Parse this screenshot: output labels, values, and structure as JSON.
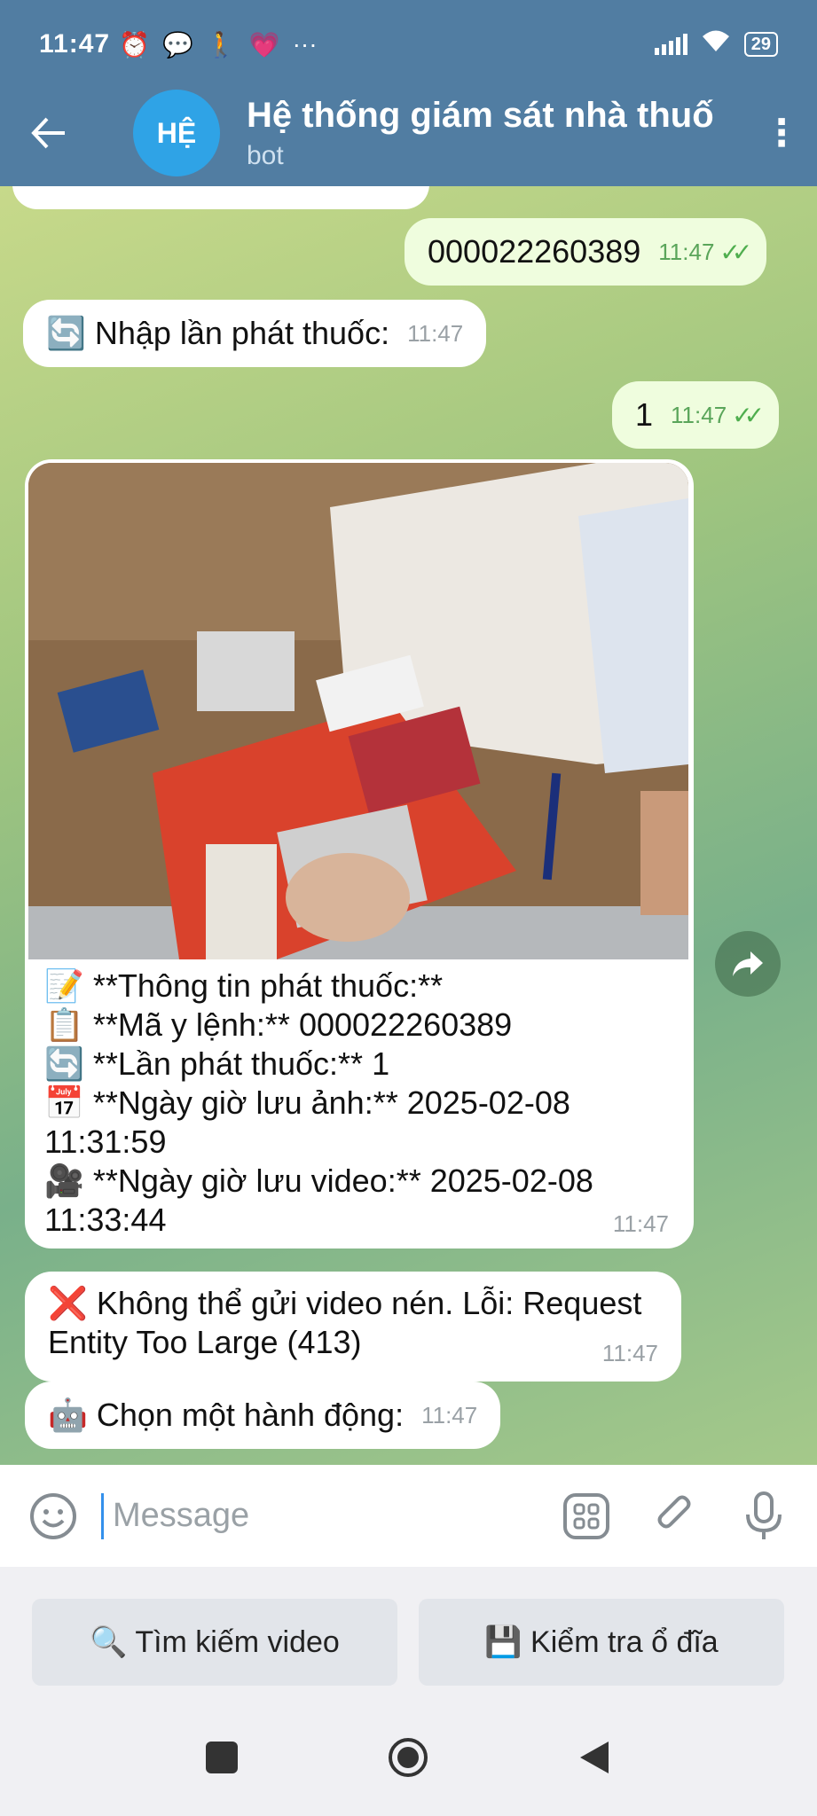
{
  "status_bar": {
    "time": "11:47",
    "battery": "29",
    "more": "···"
  },
  "header": {
    "avatar_initials": "HỆ",
    "title": "Hệ thống giám sát nhà thuố",
    "subtitle": "bot"
  },
  "messages": {
    "sent_code": {
      "text": "000022260389",
      "time": "11:47"
    },
    "prompt_dispense": {
      "icon": "🔄",
      "text": "Nhập lần phát thuốc:",
      "time": "11:47"
    },
    "sent_count": {
      "text": "1",
      "time": "11:47"
    },
    "photo_caption": {
      "lines": [
        "📝 **Thông tin phát thuốc:**",
        "📋 **Mã y lệnh:** 000022260389",
        "🔄 **Lần phát thuốc:** 1",
        "📅 **Ngày giờ lưu ảnh:** 2025-02-08",
        "11:31:59",
        "🎥 **Ngày giờ lưu video:** 2025-02-08",
        "11:33:44"
      ],
      "time": "11:47"
    },
    "error": {
      "icon": "❌",
      "text": "Không thể gửi video nén. Lỗi: Request Entity Too Large (413)",
      "time": "11:47"
    },
    "choose_action": {
      "icon": "🤖",
      "text": "Chọn một hành động:",
      "time": "11:47"
    }
  },
  "input": {
    "placeholder": "Message"
  },
  "keyboard": {
    "search_video": "🔍 Tìm kiếm video",
    "check_disk": "💾 Kiểm tra ổ đĩa"
  },
  "colors": {
    "header": "#517da2",
    "outgoing": "#effdde",
    "avatar": "#2fa3e6"
  }
}
